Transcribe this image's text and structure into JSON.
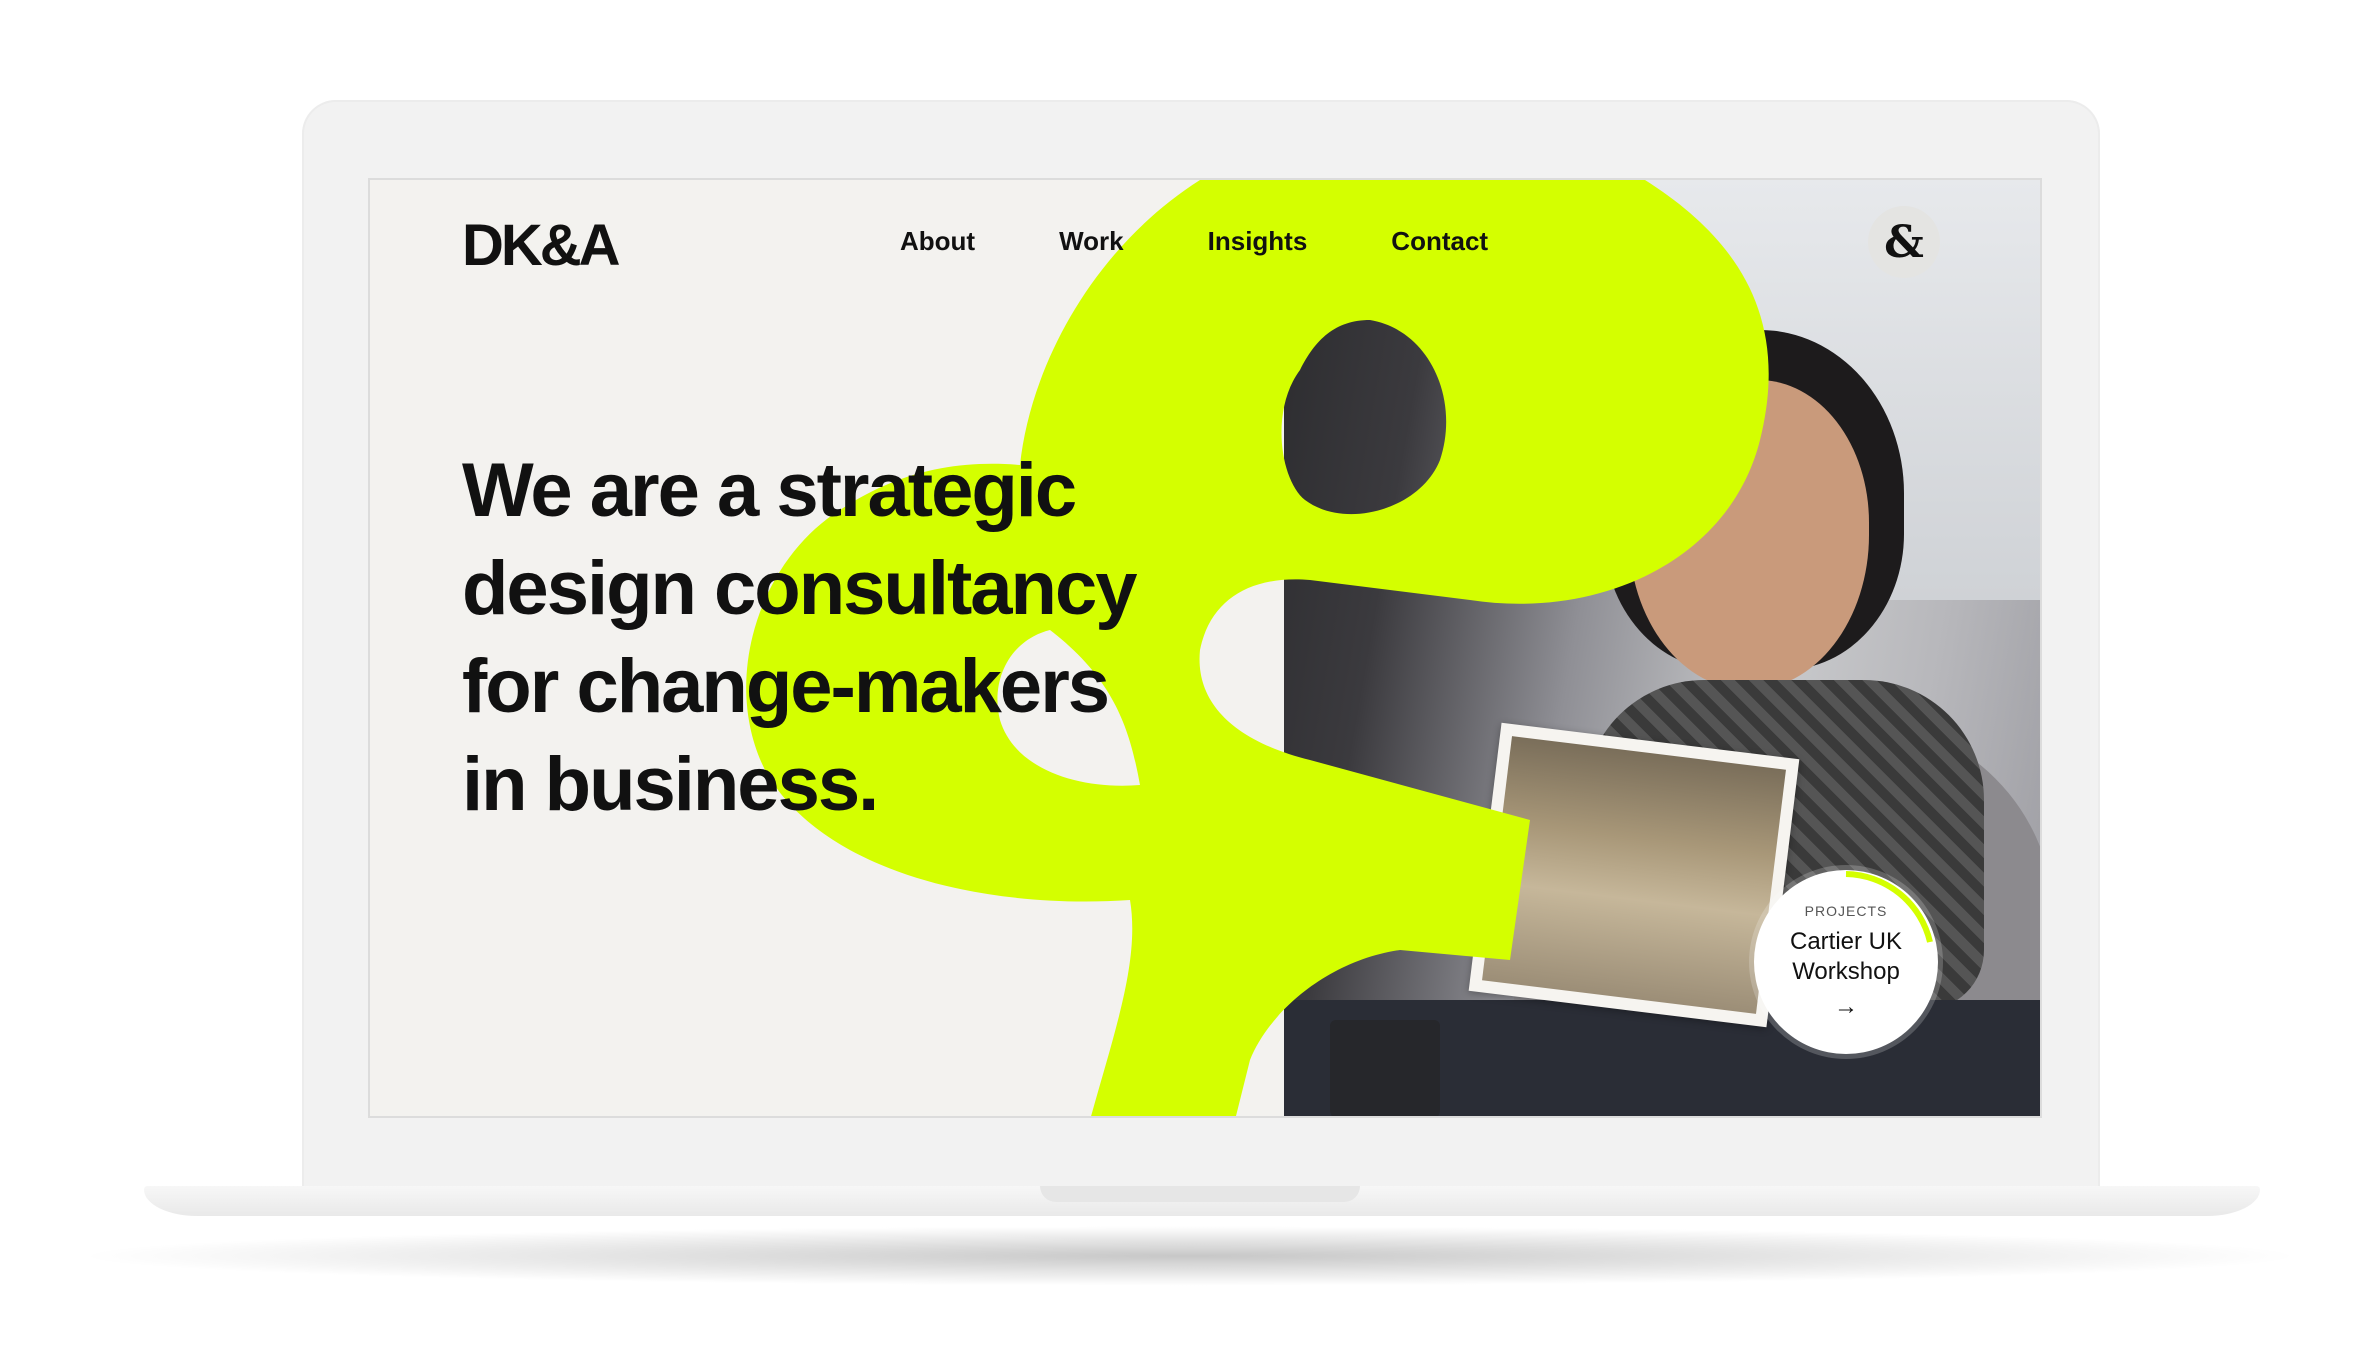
{
  "site": {
    "logo": "DK&A",
    "nav": [
      "About",
      "Work",
      "Insights",
      "Contact"
    ],
    "menu_button_icon": "ampersand-icon"
  },
  "hero": {
    "line1": "We are a strategic",
    "line2": "design consultancy",
    "line3_prefix": "for ",
    "line3_bold": "change-makers",
    "line4": "in business."
  },
  "project": {
    "label": "PROJECTS",
    "title_line1": "Cartier UK",
    "title_line2": "Workshop",
    "arrow": "→"
  },
  "colors": {
    "accent": "#d4ff00",
    "background": "#f3f2ef",
    "text": "#111111"
  }
}
